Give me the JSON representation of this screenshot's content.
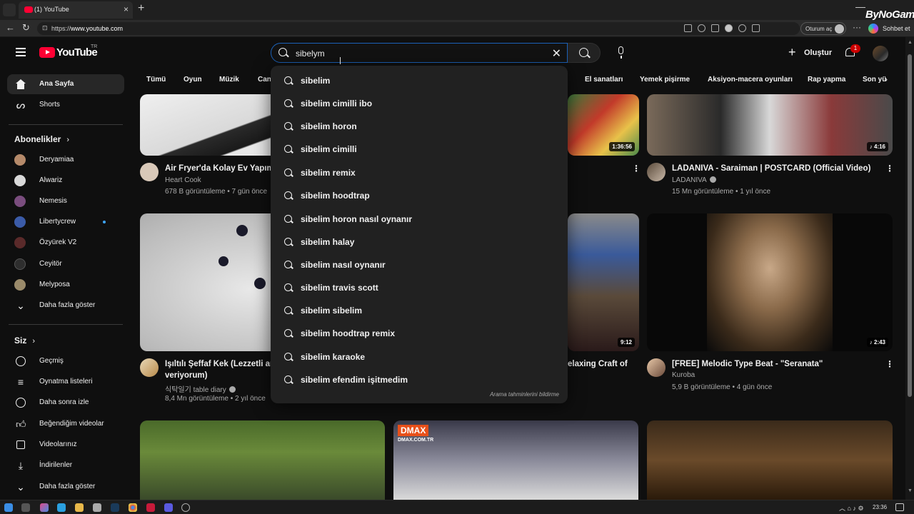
{
  "browser": {
    "tab_title": "(1) YouTube",
    "url_prefix": "https://",
    "url_host": "www.youtube.com",
    "signin_label": "Oturum aç",
    "copilot_label": "Sohbet et",
    "overlay_brand": "ByNoGame"
  },
  "header": {
    "logo_text": "YouTube",
    "country_code": "TR",
    "search_value": "sibelym",
    "create_label": "Oluştur",
    "notification_count": "1"
  },
  "sidebar": {
    "home_label": "Ana Sayfa",
    "shorts_label": "Shorts",
    "subscriptions_heading": "Abonelikler",
    "subscriptions": [
      {
        "name": "Deryamiaa",
        "color": "#b58a6a"
      },
      {
        "name": "Alwariz",
        "color": "#d9d9d9"
      },
      {
        "name": "Nemesis",
        "color": "#7a4d7e"
      },
      {
        "name": "Libertycrew",
        "color": "#3b5ba8"
      },
      {
        "name": "Özyürek V2",
        "color": "#5a2a2a"
      },
      {
        "name": "Ceyitör",
        "color": "#2e2e2e"
      },
      {
        "name": "Melyposa",
        "color": "#9a8a6a"
      }
    ],
    "show_more_1": "Daha fazla göster",
    "you_heading": "Siz",
    "you_items": [
      "Geçmiş",
      "Oynatma listeleri",
      "Daha sonra izle",
      "Beğendiğim videolar",
      "Videolarınız",
      "İndirilenler"
    ],
    "show_more_2": "Daha fazla göster"
  },
  "chips": [
    "Tümü",
    "Oyun",
    "Müzik",
    "Can",
    "El sanatları",
    "Yemek pişirme",
    "Aksiyon-macera oyunları",
    "Rap yapma",
    "Son yü"
  ],
  "videos": {
    "r1c1": {
      "title": "Air Fryer'da Kolay Ev Yapımı",
      "channel": "Heart Cook",
      "meta": "678 B görüntüleme • 7 gün önce"
    },
    "r1c2": {
      "duration": "1:36:56"
    },
    "r1c3": {
      "title": "LADANIVA - Saraiman | POSTCARD (Official Video)",
      "channel": "LADANIVA",
      "meta": "15 Mn görüntüleme • 1 yıl önce",
      "duration": "♪ 4:16"
    },
    "r2c1": {
      "title_line1": "Işıltılı Şeffaf Kek (Lezzetli ar",
      "title_line2": "veriyorum)",
      "channel": "식탁일기 table diary",
      "meta": "8,4 Mn görüntüleme • 2 yıl önce"
    },
    "r2c2": {
      "title": "elaxing Craft of",
      "duration": "9:12"
    },
    "r2c3": {
      "title": "[FREE] Melodic Type Beat - \"Seranata\"",
      "channel": "Kuroba",
      "meta": "5,9 B görüntüleme • 4 gün önce",
      "duration": "♪ 2:43"
    },
    "r3c2": {
      "brand": "DMAX",
      "brand_url": "DMAX.COM.TR"
    }
  },
  "suggestions": [
    "sibelim",
    "sibelim cimilli ibo",
    "sibelim horon",
    "sibelim cimilli",
    "sibelim remix",
    "sibelim hoodtrap",
    "sibelim horon nasıl oynanır",
    "sibelim halay",
    "sibelim nasıl oynanır",
    "sibelim travis scott",
    "sibelim sibelim",
    "sibelim hoodtrap remix",
    "sibelim karaoke",
    "sibelim efendim işitmedim"
  ],
  "suggest_report": "Arama tahminlerini bildirme",
  "taskbar": {
    "clock": "23:36"
  },
  "colors": {
    "accent": "#ff0033",
    "focus_border": "#1c62b9",
    "badge": "#cc0000",
    "link_dot": "#3ea6ff"
  }
}
